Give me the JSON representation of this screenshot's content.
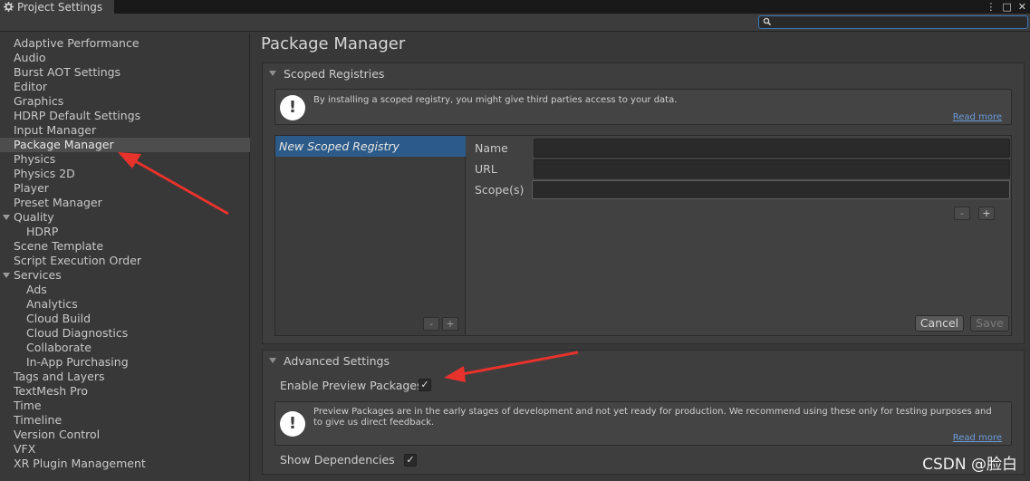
{
  "window": {
    "title": "Project Settings",
    "controls": [
      "⋮",
      "□",
      "✕"
    ]
  },
  "search": {
    "placeholder": ""
  },
  "sidebar": {
    "items": [
      {
        "label": "Adaptive Performance"
      },
      {
        "label": "Audio"
      },
      {
        "label": "Burst AOT Settings"
      },
      {
        "label": "Editor"
      },
      {
        "label": "Graphics"
      },
      {
        "label": "HDRP Default Settings"
      },
      {
        "label": "Input Manager"
      },
      {
        "label": "Package Manager",
        "selected": true
      },
      {
        "label": "Physics"
      },
      {
        "label": "Physics 2D"
      },
      {
        "label": "Player"
      },
      {
        "label": "Preset Manager"
      },
      {
        "label": "Quality",
        "foldout": true
      },
      {
        "label": "HDRP",
        "child": true
      },
      {
        "label": "Scene Template"
      },
      {
        "label": "Script Execution Order"
      },
      {
        "label": "Services",
        "foldout": true
      },
      {
        "label": "Ads",
        "child": true
      },
      {
        "label": "Analytics",
        "child": true
      },
      {
        "label": "Cloud Build",
        "child": true
      },
      {
        "label": "Cloud Diagnostics",
        "child": true
      },
      {
        "label": "Collaborate",
        "child": true
      },
      {
        "label": "In-App Purchasing",
        "child": true
      },
      {
        "label": "Tags and Layers"
      },
      {
        "label": "TextMesh Pro"
      },
      {
        "label": "Time"
      },
      {
        "label": "Timeline"
      },
      {
        "label": "Version Control"
      },
      {
        "label": "VFX"
      },
      {
        "label": "XR Plugin Management"
      }
    ]
  },
  "main": {
    "title": "Package Manager",
    "scoped": {
      "header": "Scoped Registries",
      "info": "By installing a scoped registry, you might give third parties access to your data.",
      "read_more": "Read more",
      "registry_item": "New Scoped Registry",
      "list_remove": "-",
      "list_add": "+",
      "name_label": "Name",
      "url_label": "URL",
      "scopes_label": "Scope(s)",
      "name_value": "",
      "url_value": "",
      "scopes_value": "",
      "scope_remove": "-",
      "scope_add": "+",
      "cancel": "Cancel",
      "save": "Save"
    },
    "advanced": {
      "header": "Advanced Settings",
      "enable_preview_label": "Enable Preview Packages",
      "enable_preview_checked": true,
      "preview_info": "Preview Packages are in the early stages of development and not yet ready for production. We recommend using these only for testing purposes and to give us direct feedback.",
      "read_more": "Read more",
      "show_deps_label": "Show Dependencies",
      "show_deps_checked": true
    }
  },
  "watermark": "CSDN @脸白",
  "colors": {
    "selection": "#2d5b89",
    "annotation_arrow": "#e8322c",
    "link": "#6b9bd8"
  }
}
